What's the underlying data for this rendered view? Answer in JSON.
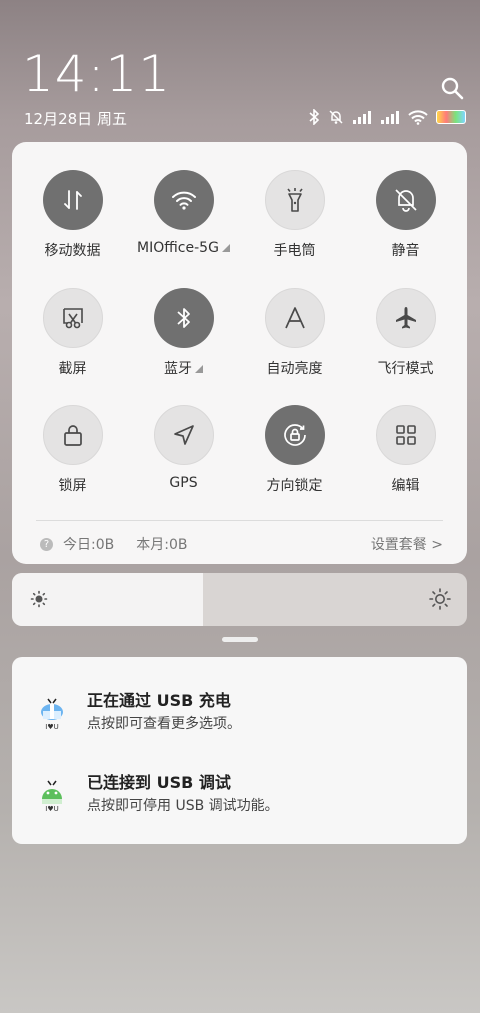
{
  "status_bar": {
    "time": "14:11",
    "date": "12月28日 周五",
    "icons": [
      "bluetooth-icon",
      "mute-icon",
      "signal-icon",
      "signal-icon",
      "wifi-icon",
      "battery-icon"
    ]
  },
  "tiles": [
    {
      "label": "移动数据",
      "icon": "mobile-data-icon",
      "active": true
    },
    {
      "label": "MIOffice-5G",
      "icon": "wifi-icon",
      "active": true,
      "expand": true
    },
    {
      "label": "手电筒",
      "icon": "flashlight-icon",
      "active": false
    },
    {
      "label": "静音",
      "icon": "mute-icon",
      "active": true
    },
    {
      "label": "截屏",
      "icon": "screenshot-icon",
      "active": false
    },
    {
      "label": "蓝牙",
      "icon": "bluetooth-icon",
      "active": true,
      "expand": true
    },
    {
      "label": "自动亮度",
      "icon": "auto-brightness-icon",
      "active": false
    },
    {
      "label": "飞行模式",
      "icon": "airplane-icon",
      "active": false
    },
    {
      "label": "锁屏",
      "icon": "lock-icon",
      "active": false
    },
    {
      "label": "GPS",
      "icon": "gps-icon",
      "active": false
    },
    {
      "label": "方向锁定",
      "icon": "rotation-lock-icon",
      "active": true
    },
    {
      "label": "编辑",
      "icon": "edit-grid-icon",
      "active": false
    }
  ],
  "usage": {
    "today": "今日:0B",
    "month": "本月:0B",
    "settings": "设置套餐 >"
  },
  "brightness": {
    "level": 0.42
  },
  "notifications": [
    {
      "title": "正在通过  USB  充电",
      "subtitle": "点按即可查看更多选项。",
      "icon": "usb-charge-icon"
    },
    {
      "title": "已连接到  USB  调试",
      "subtitle": "点按即可停用 USB 调试功能。",
      "icon": "usb-debug-icon"
    }
  ]
}
